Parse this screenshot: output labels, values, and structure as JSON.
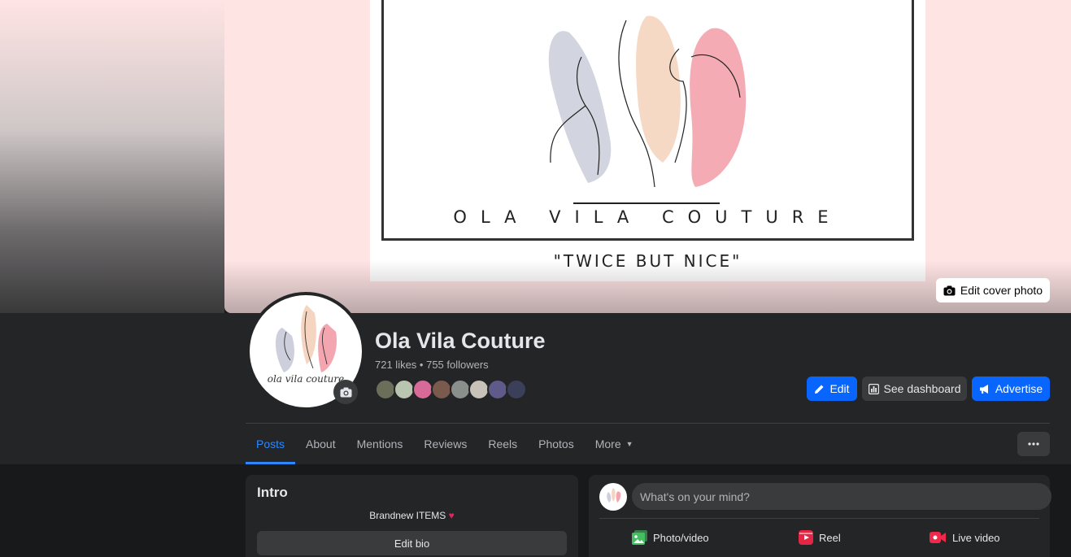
{
  "cover": {
    "brand_name": "OLA VILA COUTURE",
    "tagline": "\"TWICE BUT NICE\"",
    "edit_cover_label": "Edit cover photo"
  },
  "profile": {
    "avatar_text": "ola vila couture",
    "name": "Ola Vila Couture",
    "stats": "721 likes • 755 followers",
    "follower_faces": [
      "#6b6f5a",
      "#b9c5b0",
      "#d86a9a",
      "#7b5a4e",
      "#8a8f8c",
      "#c9c2b8",
      "#5e5a8a",
      "#3b3f5a"
    ]
  },
  "actions": {
    "edit_label": "Edit",
    "dashboard_label": "See dashboard",
    "advertise_label": "Advertise"
  },
  "tabs": [
    {
      "label": "Posts",
      "active": true
    },
    {
      "label": "About"
    },
    {
      "label": "Mentions"
    },
    {
      "label": "Reviews"
    },
    {
      "label": "Reels"
    },
    {
      "label": "Photos"
    },
    {
      "label": "More"
    }
  ],
  "more_menu_icon": "dots-icon",
  "intro": {
    "title": "Intro",
    "bio": "Brandnew ITEMS",
    "edit_bio_label": "Edit bio"
  },
  "composer": {
    "placeholder": "What's on your mind?",
    "photo_video_label": "Photo/video",
    "reel_label": "Reel",
    "live_label": "Live video"
  },
  "colors": {
    "accent": "#0866ff",
    "active_tab": "#2d88ff",
    "cover_bg": "#ffe4e4",
    "photo_icon": "#45bd62",
    "reel_icon": "#e42645",
    "live_icon": "#f02849"
  }
}
